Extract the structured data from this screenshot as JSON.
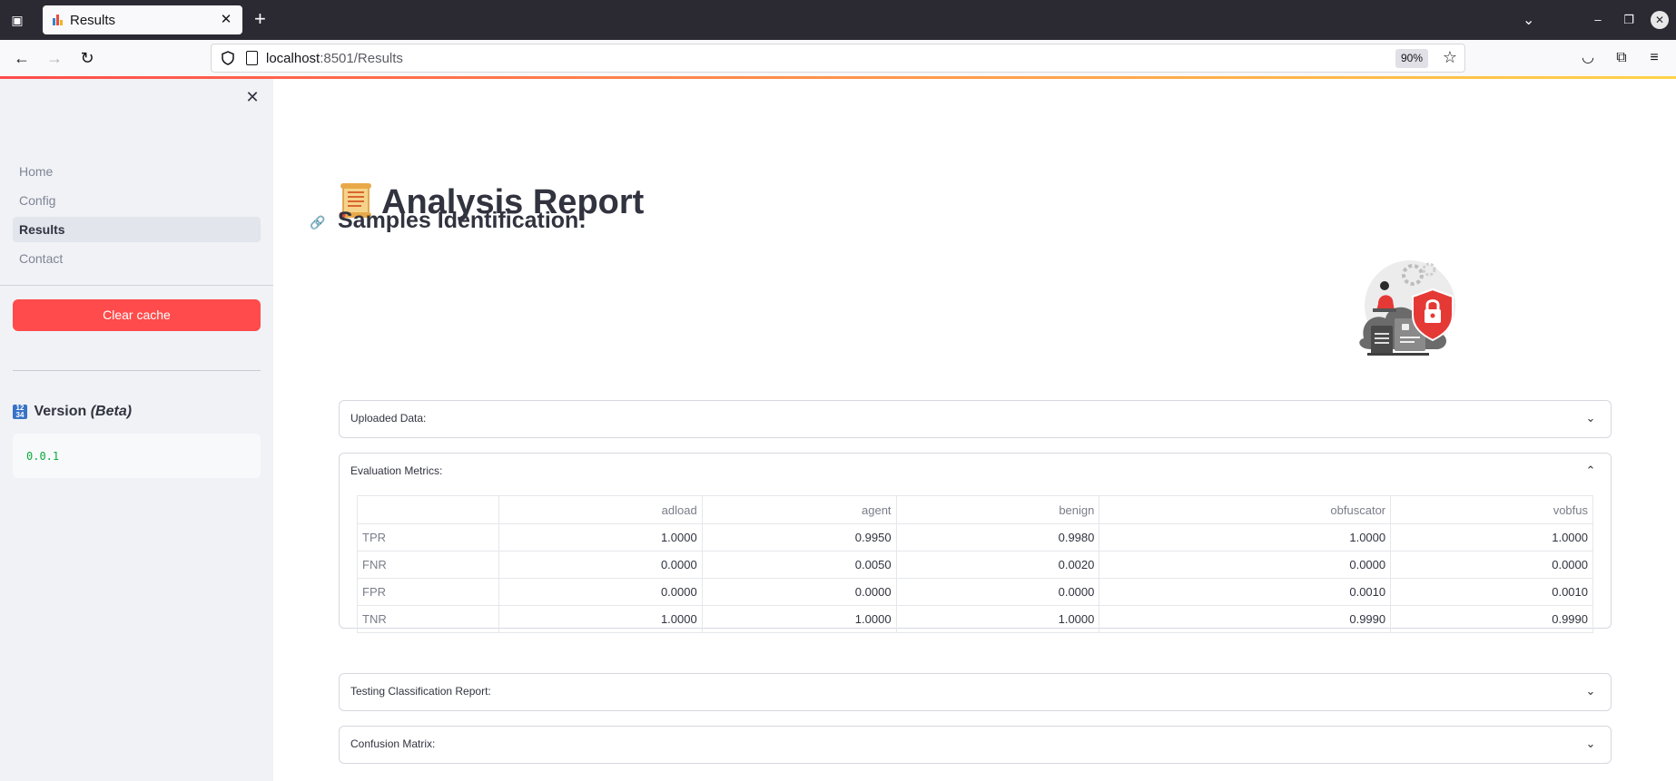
{
  "browser": {
    "tab_title": "Results",
    "url_host": "localhost",
    "url_rest": ":8501/Results",
    "zoom": "90%"
  },
  "sidebar": {
    "nav": [
      {
        "label": "Home",
        "active": false
      },
      {
        "label": "Config",
        "active": false
      },
      {
        "label": "Results",
        "active": true
      },
      {
        "label": "Contact",
        "active": false
      }
    ],
    "clear_cache_label": "Clear cache",
    "version_label": "Version",
    "version_suffix": "(Beta)",
    "version_value": "0.0.1"
  },
  "main": {
    "title": "Analysis Report",
    "section_title": "Samples Identification:",
    "expanders": {
      "uploaded": "Uploaded Data:",
      "evaluation": "Evaluation Metrics:",
      "testing": "Testing Classification Report:",
      "confusion": "Confusion Matrix:"
    },
    "metrics_table": {
      "columns": [
        "adload",
        "agent",
        "benign",
        "obfuscator",
        "vobfus"
      ],
      "rows": [
        {
          "label": "TPR",
          "values": [
            "1.0000",
            "0.9950",
            "0.9980",
            "1.0000",
            "1.0000"
          ]
        },
        {
          "label": "FNR",
          "values": [
            "0.0000",
            "0.0050",
            "0.0020",
            "0.0000",
            "0.0000"
          ]
        },
        {
          "label": "FPR",
          "values": [
            "0.0000",
            "0.0000",
            "0.0000",
            "0.0010",
            "0.0010"
          ]
        },
        {
          "label": "TNR",
          "values": [
            "1.0000",
            "1.0000",
            "1.0000",
            "0.9990",
            "0.9990"
          ]
        }
      ]
    }
  },
  "colors": {
    "accent": "#ff4b4b",
    "sidebar_bg": "#f0f2f6",
    "text": "#31333f",
    "code_green": "#09ab3b"
  }
}
